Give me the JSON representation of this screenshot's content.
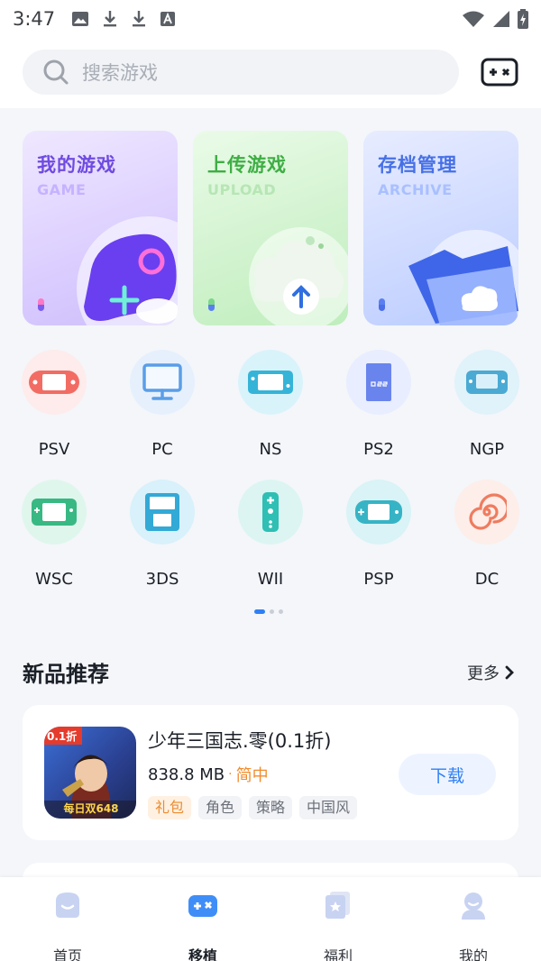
{
  "status_bar": {
    "time": "3:47",
    "left_icons": [
      "image-icon",
      "download-icon",
      "download-icon",
      "text-icon"
    ],
    "right_icons": [
      "wifi-icon",
      "signal-icon",
      "battery-charging-icon"
    ]
  },
  "search": {
    "placeholder": "搜索游戏",
    "icon": "search-icon"
  },
  "header_button_icon": "gamepad-icon",
  "cards": [
    {
      "title": "我的游戏",
      "subtitle": "GAME",
      "icon": "gamepad-plus-icon",
      "accent": "#6f4be0"
    },
    {
      "title": "上传游戏",
      "subtitle": "UPLOAD",
      "icon": "cloud-upload-icon",
      "accent": "#3fae45"
    },
    {
      "title": "存档管理",
      "subtitle": "ARCHIVE",
      "icon": "folder-cloud-icon",
      "accent": "#4770e6"
    }
  ],
  "platforms": [
    {
      "label": "PSV",
      "icon": "psv-icon",
      "bg": "#fdeceb",
      "color": "#f26c64"
    },
    {
      "label": "PC",
      "icon": "monitor-icon",
      "bg": "#e6f0fd",
      "color": "#5a9ee8"
    },
    {
      "label": "NS",
      "icon": "switch-icon",
      "bg": "#d9f3fb",
      "color": "#35b4d8"
    },
    {
      "label": "PS2",
      "icon": "ps2-icon",
      "bg": "#e8edff",
      "color": "#6a84ee"
    },
    {
      "label": "NGP",
      "icon": "ngp-icon",
      "bg": "#e0f2fa",
      "color": "#4aaad3"
    },
    {
      "label": "WSC",
      "icon": "wsc-icon",
      "bg": "#dff6ec",
      "color": "#38b883"
    },
    {
      "label": "3DS",
      "icon": "3ds-icon",
      "bg": "#d8f1fb",
      "color": "#33a9d6"
    },
    {
      "label": "WII",
      "icon": "wii-remote-icon",
      "bg": "#dcf5f3",
      "color": "#2fbfb4"
    },
    {
      "label": "PSP",
      "icon": "psp-icon",
      "bg": "#d9f3f6",
      "color": "#36b4c5"
    },
    {
      "label": "DC",
      "icon": "dc-swirl-icon",
      "bg": "#fdeee9",
      "color": "#ef7c5f"
    }
  ],
  "pager": {
    "pages": 3,
    "active": 0
  },
  "section": {
    "title": "新品推荐",
    "more": "更多"
  },
  "game": {
    "name": "少年三国志.零(0.1折)",
    "size": "838.8 MB",
    "separator": "·",
    "language": "简中",
    "tags": [
      "礼包",
      "角色",
      "策略",
      "中国风"
    ],
    "download_label": "下载",
    "icon_badge": "0.1折",
    "icon_caption": "每日双648"
  },
  "bottom_nav": [
    {
      "label": "首页",
      "icon": "home-icon",
      "active": false
    },
    {
      "label": "移植",
      "icon": "gamepad-icon",
      "active": true
    },
    {
      "label": "福利",
      "icon": "gift-cards-icon",
      "active": false
    },
    {
      "label": "我的",
      "icon": "user-icon",
      "active": false
    }
  ],
  "colors": {
    "accent_blue": "#2f80f5",
    "orange": "#f08c2e"
  }
}
